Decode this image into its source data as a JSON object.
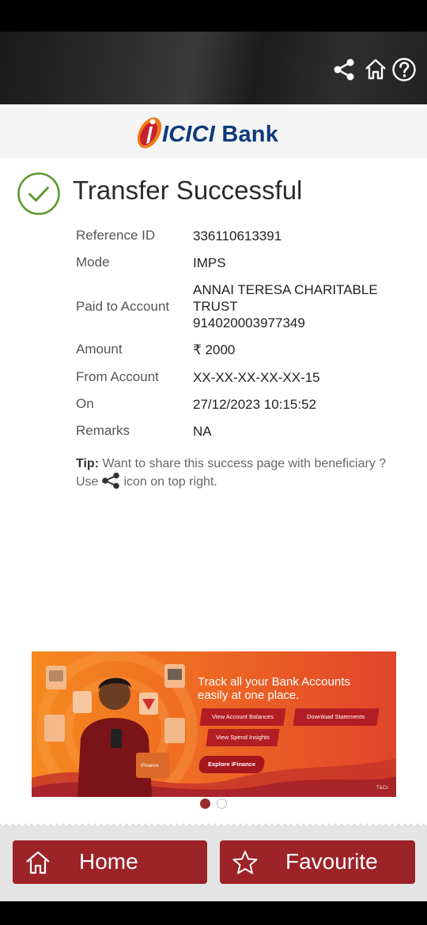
{
  "header": {
    "icons": [
      "share-icon",
      "home-icon",
      "help-icon"
    ]
  },
  "logo": {
    "brand": "ICICI",
    "bank": "Bank",
    "colors": {
      "navy": "#0d3a7a",
      "orange": "#f07a1a",
      "red": "#c8202e"
    }
  },
  "status": {
    "title": "Transfer Successful",
    "icon": "check-circle-icon",
    "color": "#5a9a2e"
  },
  "details": [
    {
      "label": "Reference ID",
      "value": "336110613391"
    },
    {
      "label": "Mode",
      "value": "IMPS"
    },
    {
      "label": "Paid to Account",
      "value_lines": [
        "ANNAI TERESA CHARITABLE",
        "TRUST",
        "914020003977349"
      ]
    },
    {
      "label": "Amount",
      "value": "₹ 2000"
    },
    {
      "label": "From Account",
      "value": "XX-XX-XX-XX-XX-15"
    },
    {
      "label": "On",
      "value": "27/12/2023 10:15:52"
    },
    {
      "label": "Remarks",
      "value": "NA"
    }
  ],
  "tip": {
    "prefix": "Tip:",
    "text_before": " Want to share this success page with beneficiary ? Use",
    "text_after": "icon on top right."
  },
  "banner": {
    "title_line1": "Track all your Bank Accounts",
    "title_line2": "easily at one place.",
    "btn_balances": "View Account Balances",
    "btn_statements": "Download Statements",
    "btn_insights": "View Spend Insights",
    "btn_explore": "Explore iFinance",
    "phone_badge": "iFinance",
    "tcs": "T&Cs",
    "active_slide": 1,
    "total_slides": 2
  },
  "footer": {
    "home_label": "Home",
    "fav_label": "Favourite",
    "color": "#9c2328"
  }
}
